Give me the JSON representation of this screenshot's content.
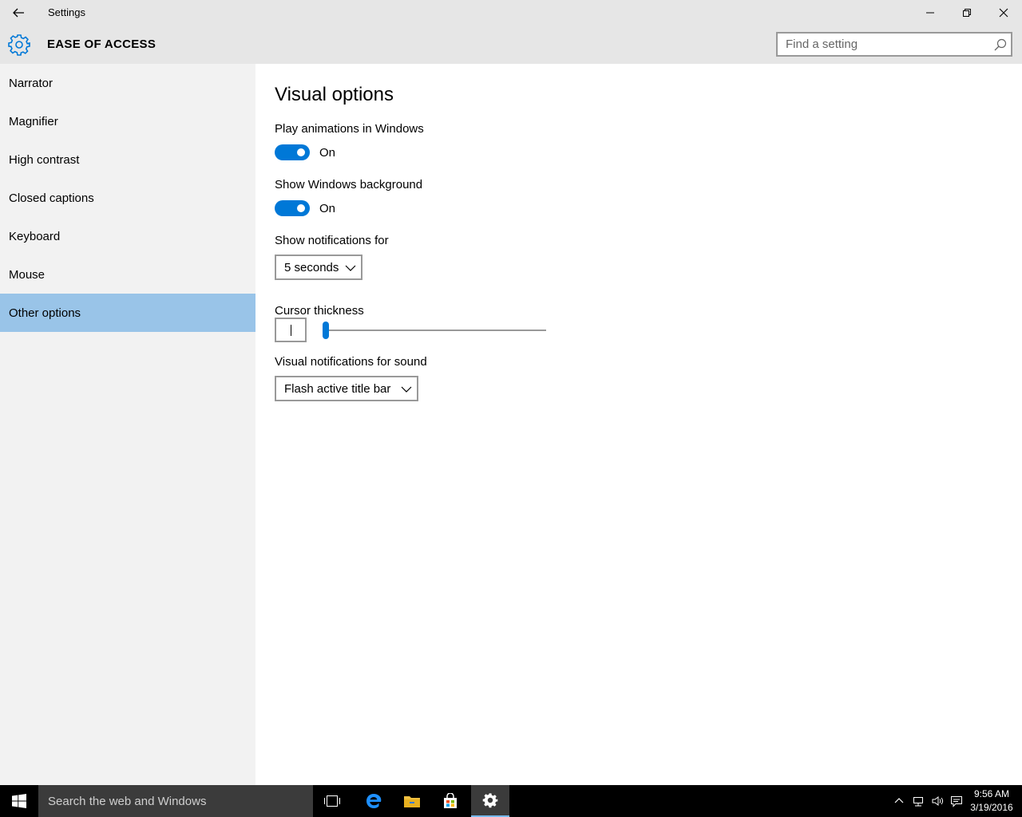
{
  "window": {
    "title": "Settings"
  },
  "header": {
    "section_title": "EASE OF ACCESS",
    "search_placeholder": "Find a setting"
  },
  "sidebar": {
    "items": [
      {
        "label": "Narrator",
        "selected": false
      },
      {
        "label": "Magnifier",
        "selected": false
      },
      {
        "label": "High contrast",
        "selected": false
      },
      {
        "label": "Closed captions",
        "selected": false
      },
      {
        "label": "Keyboard",
        "selected": false
      },
      {
        "label": "Mouse",
        "selected": false
      },
      {
        "label": "Other options",
        "selected": true
      }
    ]
  },
  "main": {
    "title": "Visual options",
    "play_animations": {
      "label": "Play animations in Windows",
      "state": "On"
    },
    "show_background": {
      "label": "Show Windows background",
      "state": "On"
    },
    "notifications": {
      "label": "Show notifications for",
      "value": "5 seconds"
    },
    "cursor_thickness": {
      "label": "Cursor thickness",
      "level": 0.0
    },
    "visual_sound": {
      "label": "Visual notifications for sound",
      "value": "Flash active title bar"
    }
  },
  "taskbar": {
    "search_placeholder": "Search the web and Windows",
    "time": "9:56 AM",
    "date": "3/19/2016"
  },
  "colors": {
    "accent": "#0078d7",
    "selected_item": "#99c4e8",
    "sidebar_bg": "#f2f2f2",
    "header_bg": "#e6e6e6",
    "taskbar_bg": "#000000"
  }
}
